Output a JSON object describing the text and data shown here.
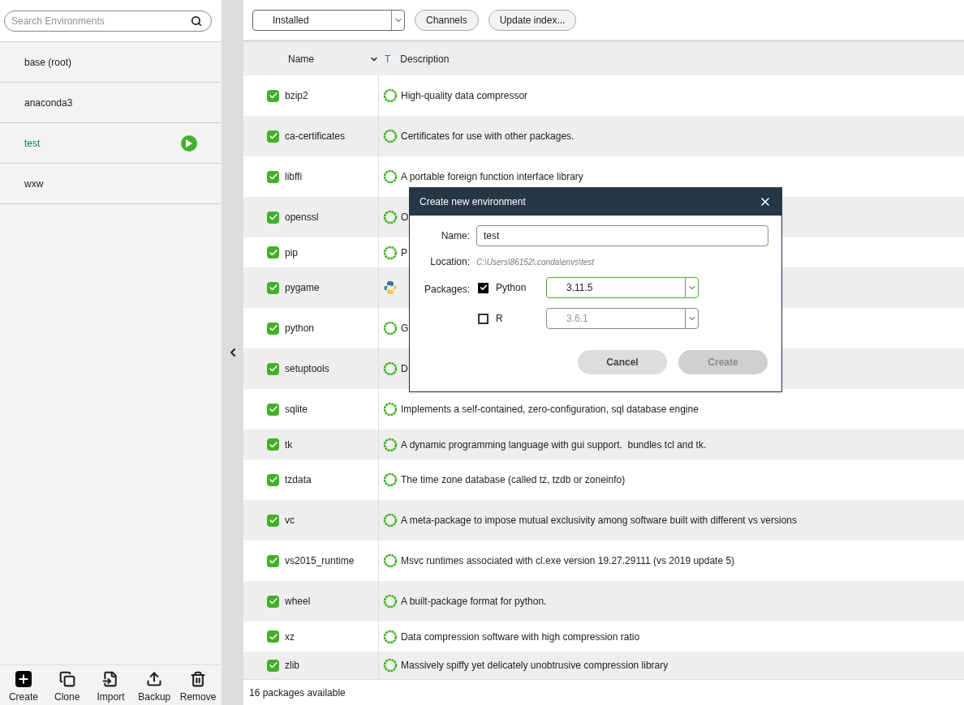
{
  "sidebar": {
    "search": {
      "placeholder": "Search Environments"
    },
    "environments": [
      {
        "name": "base (root)",
        "selected": false
      },
      {
        "name": "anaconda3",
        "selected": false
      },
      {
        "name": "test",
        "selected": true
      },
      {
        "name": "wxw",
        "selected": false
      }
    ],
    "actions": [
      {
        "label": "Create",
        "kind": "create"
      },
      {
        "label": "Clone",
        "kind": "clone"
      },
      {
        "label": "Import",
        "kind": "import"
      },
      {
        "label": "Backup",
        "kind": "backup"
      },
      {
        "label": "Remove",
        "kind": "remove"
      }
    ]
  },
  "toolbar": {
    "filter": {
      "value": "Installed"
    },
    "buttons": [
      "Channels",
      "Update index..."
    ]
  },
  "table": {
    "columns": [
      "Name",
      "T",
      "Description"
    ],
    "rows": [
      {
        "name": "bzip2",
        "checked": true,
        "kind": "conda",
        "description": "High-quality data compressor"
      },
      {
        "name": "ca-certificates",
        "checked": true,
        "kind": "conda",
        "description": "Certificates for use with other packages."
      },
      {
        "name": "libffi",
        "checked": true,
        "kind": "conda",
        "description": "A portable foreign function interface library"
      },
      {
        "name": "openssl",
        "checked": true,
        "kind": "conda",
        "description": "O"
      },
      {
        "name": "pip",
        "checked": true,
        "kind": "conda",
        "description": "P"
      },
      {
        "name": "pygame",
        "checked": true,
        "kind": "pip"
      },
      {
        "name": "python",
        "checked": true,
        "kind": "conda",
        "description": "G"
      },
      {
        "name": "setuptools",
        "checked": true,
        "kind": "conda",
        "description": "D"
      },
      {
        "name": "sqlite",
        "checked": true,
        "kind": "conda",
        "description": "Implements a self-contained, zero-configuration, sql database engine"
      },
      {
        "name": "tk",
        "checked": true,
        "kind": "conda",
        "description": "A dynamic programming language with gui support.  bundles tcl and tk."
      },
      {
        "name": "tzdata",
        "checked": true,
        "kind": "conda",
        "description": "The time zone database (called tz, tzdb or zoneinfo)"
      },
      {
        "name": "vc",
        "checked": true,
        "kind": "conda",
        "description": "A meta-package to impose mutual exclusivity among software built with different vs versions"
      },
      {
        "name": "vs2015_runtime",
        "checked": true,
        "kind": "conda",
        "description": "Msvc runtimes associated with cl.exe version 19.27.29111 (vs 2019 update 5)"
      },
      {
        "name": "wheel",
        "checked": true,
        "kind": "conda",
        "description": "A built-package format for python."
      },
      {
        "name": "xz",
        "checked": true,
        "kind": "conda",
        "description": "Data compression software with high compression ratio"
      },
      {
        "name": "zlib",
        "checked": true,
        "kind": "conda",
        "description": "Massively spiffy yet delicately unobtrusive compression library"
      }
    ]
  },
  "status_bar": "16 packages available",
  "dialog": {
    "title": "Create new environment",
    "name_label": "Name:",
    "name_value": "test",
    "location_label": "Location:",
    "location": "C:\\Users\\86152\\.conda\\envs\\test",
    "packages_label": "Packages:",
    "packages": [
      {
        "name": "Python",
        "checked": true,
        "version": "3.11.5"
      },
      {
        "name": "R",
        "checked": false,
        "version": "3.6.1"
      }
    ],
    "buttons": [
      {
        "label": "Cancel",
        "disabled": false
      },
      {
        "label": "Create",
        "disabled": true
      }
    ]
  }
}
